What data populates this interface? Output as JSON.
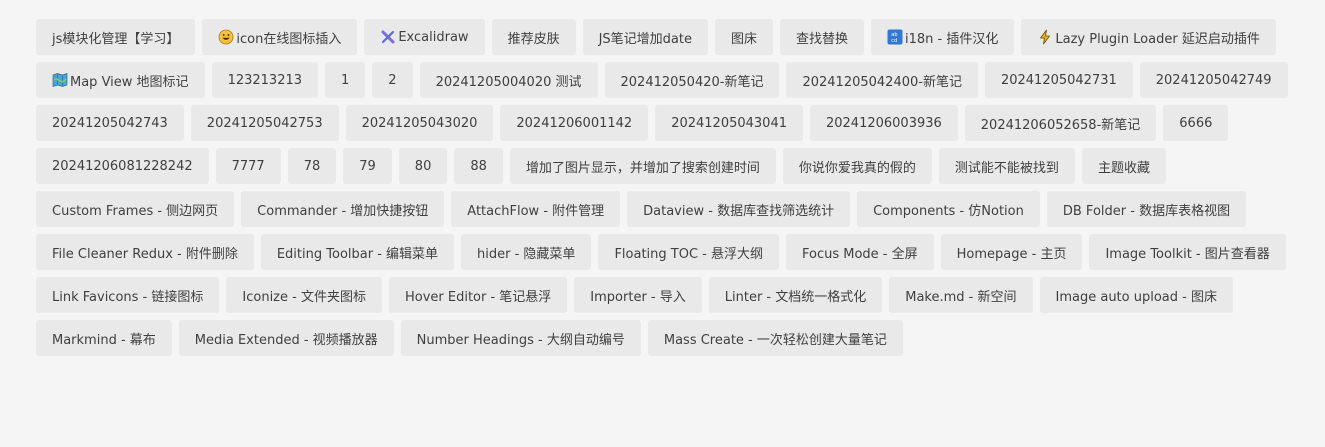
{
  "tags": [
    {
      "label": "js模块化管理【学习】"
    },
    {
      "label": "icon在线图标插入",
      "icon": "grinning-face-icon"
    },
    {
      "label": "Excalidraw",
      "icon": "excalidraw-icon"
    },
    {
      "label": "推荐皮肤"
    },
    {
      "label": "JS笔记增加date"
    },
    {
      "label": "图床"
    },
    {
      "label": "查找替换"
    },
    {
      "label": "i18n - 插件汉化",
      "icon": "abcd-icon"
    },
    {
      "label": "Lazy Plugin Loader 延迟启动插件",
      "icon": "lightning-icon"
    },
    {
      "label": "Map View 地图标记",
      "icon": "map-icon"
    },
    {
      "label": "123213213"
    },
    {
      "label": "1"
    },
    {
      "label": "2"
    },
    {
      "label": "20241205004020 测试"
    },
    {
      "label": "202412050420-新笔记"
    },
    {
      "label": "20241205042400-新笔记"
    },
    {
      "label": "20241205042731"
    },
    {
      "label": "20241205042749"
    },
    {
      "label": "20241205042743"
    },
    {
      "label": "20241205042753"
    },
    {
      "label": "20241205043020"
    },
    {
      "label": "20241206001142"
    },
    {
      "label": "20241205043041"
    },
    {
      "label": "20241206003936"
    },
    {
      "label": "20241206052658-新笔记"
    },
    {
      "label": "6666"
    },
    {
      "label": "20241206081228242"
    },
    {
      "label": "7777"
    },
    {
      "label": "78"
    },
    {
      "label": "79"
    },
    {
      "label": "80"
    },
    {
      "label": "88"
    },
    {
      "label": "增加了图片显示，并增加了搜索创建时间"
    },
    {
      "label": "你说你爱我真的假的"
    },
    {
      "label": "测试能不能被找到"
    },
    {
      "label": "主题收藏"
    },
    {
      "label": "Custom Frames - 侧边网页"
    },
    {
      "label": "Commander - 增加快捷按钮"
    },
    {
      "label": "AttachFlow - 附件管理"
    },
    {
      "label": "Dataview - 数据库查找筛选统计"
    },
    {
      "label": "Components - 仿Notion"
    },
    {
      "label": "DB Folder - 数据库表格视图"
    },
    {
      "label": "File Cleaner Redux - 附件删除"
    },
    {
      "label": "Editing Toolbar - 编辑菜单"
    },
    {
      "label": "hider - 隐藏菜单"
    },
    {
      "label": "Floating TOC - 悬浮大纲"
    },
    {
      "label": "Focus Mode - 全屏"
    },
    {
      "label": "Homepage - 主页"
    },
    {
      "label": "Image Toolkit - 图片查看器"
    },
    {
      "label": "Link Favicons - 链接图标"
    },
    {
      "label": "Iconize - 文件夹图标"
    },
    {
      "label": "Hover Editor - 笔记悬浮"
    },
    {
      "label": "Importer - 导入"
    },
    {
      "label": "Linter - 文档统一格式化"
    },
    {
      "label": "Make.md - 新空间"
    },
    {
      "label": "Image auto upload - 图床"
    },
    {
      "label": "Markmind - 幕布"
    },
    {
      "label": "Media Extended - 视频播放器"
    },
    {
      "label": "Number Headings - 大纲自动编号"
    },
    {
      "label": "Mass Create - 一次轻松创建大量笔记"
    }
  ]
}
